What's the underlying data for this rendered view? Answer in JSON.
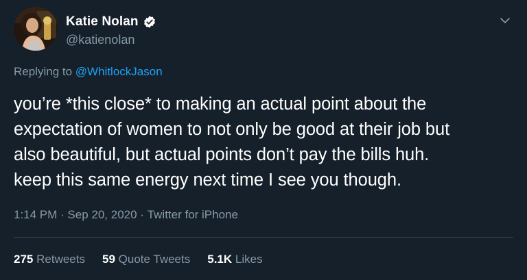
{
  "author": {
    "display_name": "Katie Nolan",
    "handle": "@katienolan",
    "verified": true,
    "avatar_icon": "profile-photo"
  },
  "reply": {
    "prefix": "Replying to",
    "mention": "@WhitlockJason"
  },
  "tweet": {
    "lines": [
      "you’re *this close* to making an actual point about the",
      "expectation of women to not only be good at their job but",
      "also beautiful, but actual points don’t pay the bills huh.",
      "keep this same energy next time I see you though."
    ]
  },
  "meta": {
    "time": "1:14 PM",
    "separator": " · ",
    "date": "Sep 20, 2020",
    "source": "Twitter for iPhone"
  },
  "stats": {
    "retweets_count": "275",
    "retweets_label": "Retweets",
    "quotes_count": "59",
    "quotes_label": "Quote Tweets",
    "likes_count": "5.1K",
    "likes_label": "Likes"
  },
  "colors": {
    "background": "#15202b",
    "secondary_text": "#8899a6",
    "accent": "#1da1f2",
    "divider": "#38444d"
  }
}
